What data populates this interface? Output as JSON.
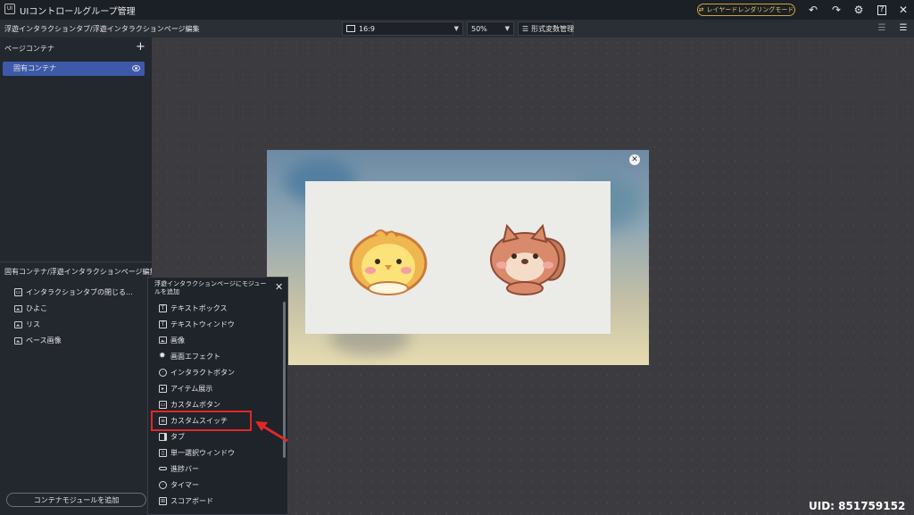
{
  "titlebar": {
    "logo": "UI",
    "title": "UIコントロールグループ管理",
    "layer_mode_label": "レイヤードレンダリングモード",
    "icons": [
      "undo-icon",
      "redo-icon",
      "settings-icon",
      "help-icon",
      "close-icon"
    ]
  },
  "toolbar": {
    "breadcrumb": "浮遊インタラクションタブ/浮遊インタラクションページ編集",
    "aspect_ratio": "16:9",
    "zoom": "50%",
    "format_button": "形式変数管理"
  },
  "left_panel": {
    "page_container_title": "ページコンテナ",
    "container_item": "固有コンテナ",
    "edit_section_title": "固有コンテナ/浮遊インタラクションページ編集",
    "tree_items": [
      "インタラクションタブの閉じる...",
      "ひよこ",
      "リス",
      "ベース画像"
    ],
    "add_module_button": "コンテナモジュールを追加"
  },
  "modal": {
    "title": "浮遊インタラクションページにモジュールを追加",
    "items": [
      "テキストボックス",
      "テキストウィンドウ",
      "画像",
      "画面エフェクト",
      "インタラクトボタン",
      "アイテム展示",
      "カスタムボタン",
      "カスタムスイッチ",
      "タブ",
      "単一選択ウィンドウ",
      "進捗バー",
      "タイマー",
      "スコアボード"
    ],
    "highlighted_item": "カスタムスイッチ"
  },
  "uid": "UID: 851759152",
  "colors": {
    "accent": "#3d5aa8",
    "highlight": "#e0282a",
    "layer_mode": "#e8c860"
  }
}
